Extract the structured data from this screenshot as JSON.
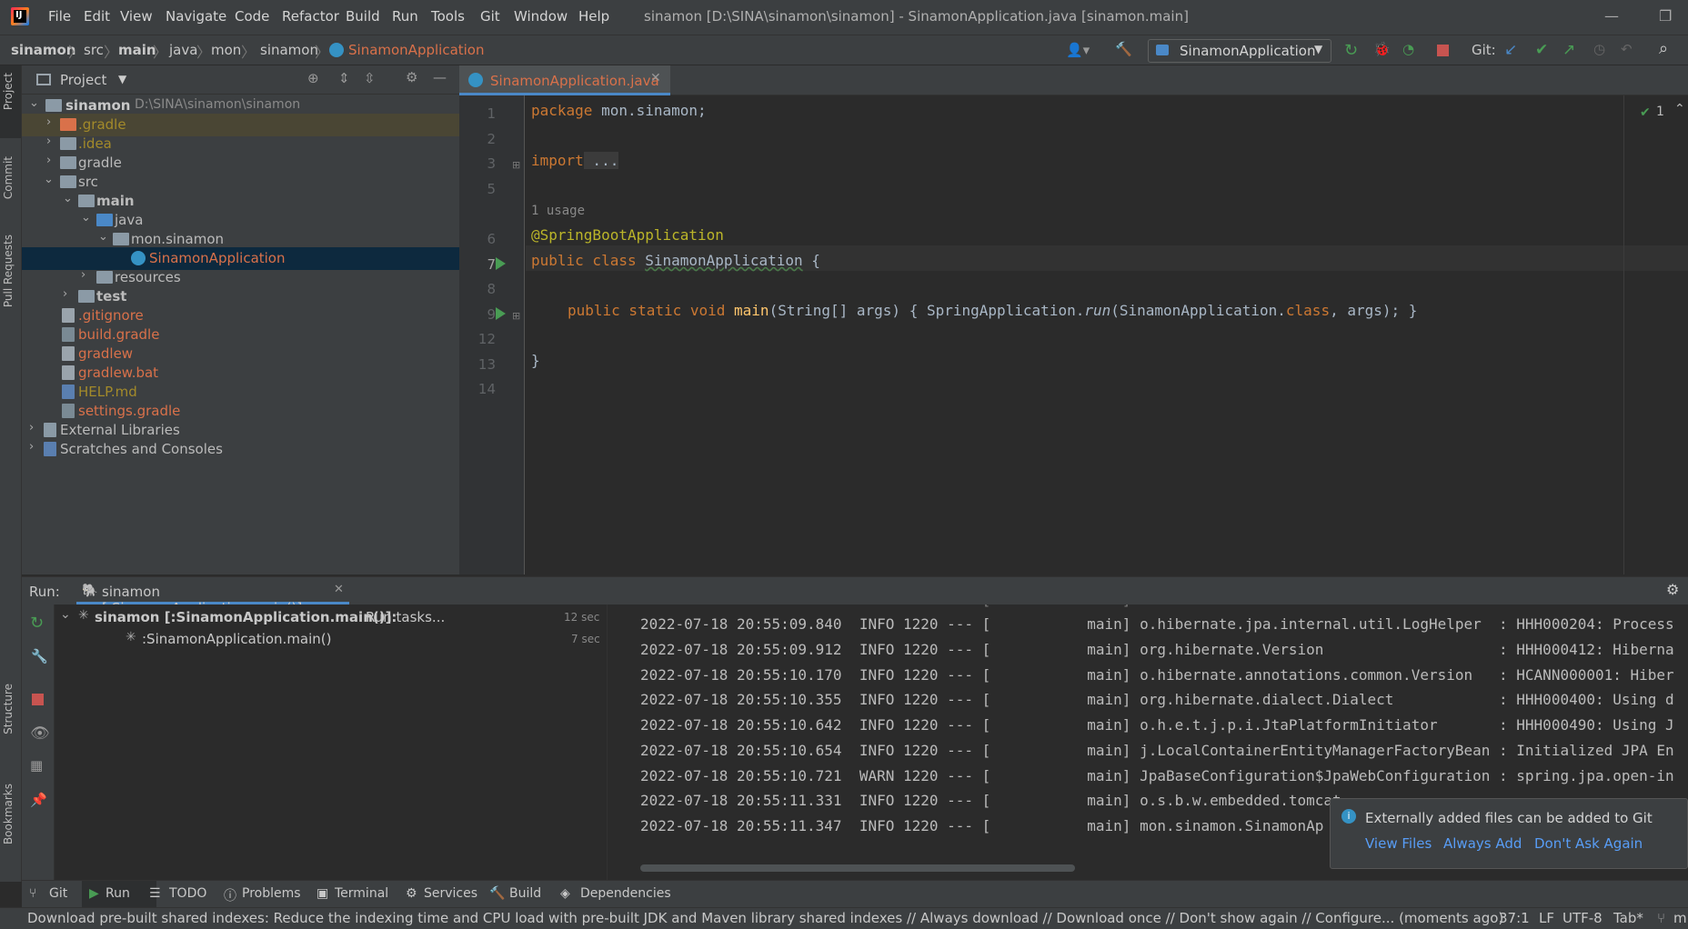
{
  "menubar": {
    "items": [
      "File",
      "Edit",
      "View",
      "Navigate",
      "Code",
      "Refactor",
      "Build",
      "Run",
      "Tools",
      "Git",
      "Window",
      "Help"
    ],
    "window_title": "sinamon [D:\\SINA\\sinamon\\sinamon] - SinamonApplication.java [sinamon.main]"
  },
  "navbar": {
    "crumbs": [
      "sinamon",
      "src",
      "main",
      "java",
      "mon",
      "sinamon",
      "SinamonApplication"
    ],
    "run_config": "SinamonApplication",
    "git_label": "Git:"
  },
  "side_tabs": {
    "project": "Project",
    "commit": "Commit",
    "pull_requests": "Pull Requests",
    "structure": "Structure",
    "bookmarks": "Bookmarks"
  },
  "project": {
    "title": "Project",
    "root_name": "sinamon",
    "root_path": "D:\\SINA\\sinamon\\sinamon",
    "items": [
      ".gradle",
      ".idea",
      "gradle",
      "src",
      "main",
      "java",
      "mon.sinamon",
      "SinamonApplication",
      "resources",
      "test",
      ".gitignore",
      "build.gradle",
      "gradlew",
      "gradlew.bat",
      "HELP.md",
      "settings.gradle",
      "External Libraries",
      "Scratches and Consoles"
    ]
  },
  "editor": {
    "tab": "SinamonApplication.java",
    "inspection_count": "1",
    "line_numbers": [
      "1",
      "2",
      "3",
      "5",
      "6",
      "7",
      "8",
      "9",
      "12",
      "13",
      "14"
    ],
    "usage_hint": "1 usage",
    "code": {
      "l1_kw": "package",
      "l1_rest": " mon.sinamon;",
      "l3_kw": "import",
      "l3_rest": " ...",
      "l6": "@SpringBootApplication",
      "l7_kw": "public class ",
      "l7_name": "SinamonApplication",
      "l7_rest": " {",
      "l9_kw": "public static void ",
      "l9_fn": "main",
      "l9_a": "(String[] args) { SpringApplication.",
      "l9_run": "run",
      "l9_b": "(SinamonApplication.",
      "l9_cls": "class",
      "l9_c": ", args); }",
      "l13": "}"
    }
  },
  "run": {
    "label": "Run:",
    "tab": "sinamon [:SinamonApplication.main()]",
    "task_root": "sinamon [:SinamonApplication.main()]:",
    "task_root_suffix": " Run tasks...",
    "task_root_time": "12 sec",
    "task_child": ":SinamonApplication.main()",
    "task_child_time": "7 sec"
  },
  "console": {
    "lines": [
      "2022-07-18 20:55:09.840  INFO 1220 --- [           main] o.hibernate.jpa.internal.util.LogHelper  : HHH000204: Process",
      "2022-07-18 20:55:09.912  INFO 1220 --- [           main] org.hibernate.Version                    : HHH000412: Hiberna",
      "2022-07-18 20:55:10.170  INFO 1220 --- [           main] o.hibernate.annotations.common.Version   : HCANN000001: Hiber",
      "2022-07-18 20:55:10.355  INFO 1220 --- [           main] org.hibernate.dialect.Dialect            : HHH000400: Using d",
      "2022-07-18 20:55:10.642  INFO 1220 --- [           main] o.h.e.t.j.p.i.JtaPlatformInitiator       : HHH000490: Using J",
      "2022-07-18 20:55:10.654  INFO 1220 --- [           main] j.LocalContainerEntityManagerFactoryBean : Initialized JPA En",
      "2022-07-18 20:55:10.721  WARN 1220 --- [           main] JpaBaseConfiguration$JpaWebConfiguration : spring.jpa.open-in",
      "2022-07-18 20:55:11.331  INFO 1220 --- [           main] o.s.b.w.embedded.tomcat",
      "2022-07-18 20:55:11.347  INFO 1220 --- [           main] mon.sinamon.SinamonAp"
    ]
  },
  "notification": {
    "message": "Externally added files can be added to Git",
    "view_files": "View Files",
    "always_add": "Always Add",
    "dont_ask": "Don't Ask Again"
  },
  "toolwindows": [
    "Git",
    "Run",
    "TODO",
    "Problems",
    "Terminal",
    "Services",
    "Build",
    "Dependencies"
  ],
  "status": {
    "message": "Download pre-built shared indexes: Reduce the indexing time and CPU load with pre-built JDK and Maven library shared indexes // Always download // Download once // Don't show again // Configure... (moments ago)",
    "position": "37:1",
    "line_sep": "LF",
    "encoding": "UTF-8",
    "indent": "Tab*",
    "branch": "m"
  },
  "colors": {
    "accent": "#4a88c7",
    "run_green": "#499c54",
    "stop_red": "#c75450",
    "vcs_red": "#d9714a",
    "link": "#589df6"
  }
}
